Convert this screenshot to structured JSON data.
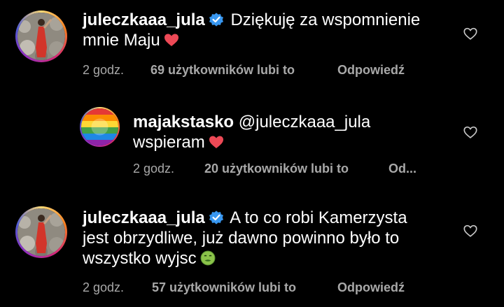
{
  "comments": [
    {
      "username": "juleczkaaa_jula",
      "text_line1": "Dziękuję za wspomnienie",
      "text_line2": "mnie Maju",
      "time": "2 godz.",
      "likes": "69 użytkowników lubi to",
      "reply": "Odpowiedź"
    },
    {
      "username": "majakstasko",
      "mention": "@juleczkaaa_jula",
      "text_line2": "wspieram",
      "time": "2 godz.",
      "likes": "20 użytkowników lubi to",
      "reply": "Od..."
    },
    {
      "username": "juleczkaaa_jula",
      "text_line1": "A to co robi Kamerzysta",
      "text_line2": "jest obrzydliwe, już dawno powinno było to",
      "text_line3": "wszystko wyjsc",
      "time": "2 godz.",
      "likes": "57 użytkowników lubi to",
      "reply": "Odpowiedź"
    }
  ],
  "colors": {
    "background": "#000000",
    "meta_text": "#a8a8a8",
    "verified_badge": "#3897f0",
    "heart": "#ed4956"
  },
  "icons": [
    "verified-badge-icon",
    "red-heart-icon",
    "nauseated-face-icon",
    "heart-outline-icon"
  ]
}
